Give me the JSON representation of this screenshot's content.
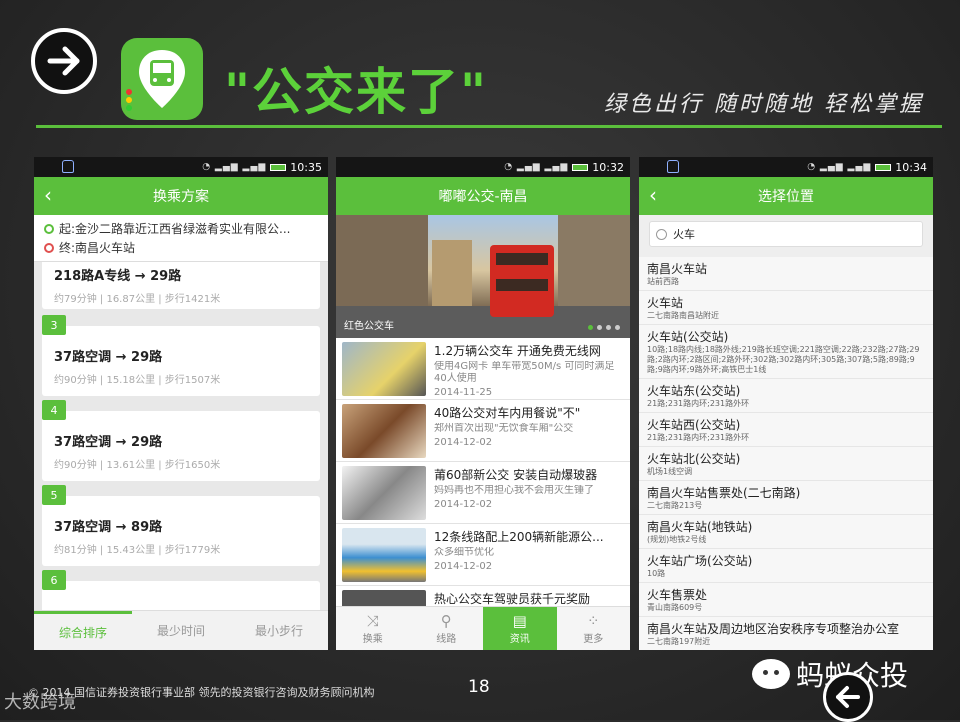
{
  "header": {
    "title": "\"公交来了\"",
    "slogan": "绿色出行 随时随地 轻松掌握"
  },
  "phone1": {
    "time": "10:35",
    "title": "换乘方案",
    "origin": "起:金沙二路靠近江西省绿滋肴实业有限公...",
    "destination": "终:南昌火车站",
    "plans": [
      {
        "num": "",
        "route": "218路A专线 → 29路",
        "meta": "约79分钟 | 16.87公里 | 步行1421米"
      },
      {
        "num": "3",
        "route": "37路空调 → 29路",
        "meta": "约90分钟 | 15.18公里 | 步行1507米"
      },
      {
        "num": "4",
        "route": "37路空调 → 29路",
        "meta": "约90分钟 | 13.61公里 | 步行1650米"
      },
      {
        "num": "5",
        "route": "37路空调 → 89路",
        "meta": "约81分钟 | 15.43公里 | 步行1779米"
      },
      {
        "num": "6",
        "route": "",
        "meta": ""
      }
    ],
    "tabs": [
      "综合排序",
      "最少时间",
      "最小步行"
    ]
  },
  "phone2": {
    "time": "10:32",
    "title": "嘟嘟公交-南昌",
    "banner_caption": "红色公交车",
    "news": [
      {
        "headline": "1.2万辆公交车 开通免费无线网",
        "summary": "使用4G网卡 单车带宽50M/s 可同时满足40人使用",
        "date": "2014-11-25"
      },
      {
        "headline": "40路公交对车内用餐说\"不\"",
        "summary": "郑州首次出现\"无饮食车厢\"公交",
        "date": "2014-12-02"
      },
      {
        "headline": "莆60部新公交 安装自动爆玻器",
        "summary": "妈妈再也不用担心我不会用灭生锤了",
        "date": "2014-12-02"
      },
      {
        "headline": "12条线路配上200辆新能源公...",
        "summary": "众多细节优化",
        "date": "2014-12-02"
      },
      {
        "headline": "热心公交车驾驶员获千元奖励",
        "summary": "",
        "date": ""
      }
    ],
    "tabs": [
      {
        "label": "换乘",
        "icon": "⤨"
      },
      {
        "label": "线路",
        "icon": "⚲"
      },
      {
        "label": "资讯",
        "icon": "▤"
      },
      {
        "label": "更多",
        "icon": "⁘"
      }
    ]
  },
  "phone3": {
    "time": "10:34",
    "title": "选择位置",
    "search_value": "火车",
    "locations": [
      {
        "name": "南昌火车站",
        "addr": "站前西路"
      },
      {
        "name": "火车站",
        "addr": "二七南路南昌站附近"
      },
      {
        "name": "火车站(公交站)",
        "addr": "10路;18路内线;18路外线;219路长班空调;221路空调;22路;232路;27路;29路;2路内环;2路区间;2路外环;302路;302路内环;305路;307路;5路;89路;9路;9路内环;9路外环;高铁巴士1线"
      },
      {
        "name": "火车站东(公交站)",
        "addr": "21路;231路内环;231路外环"
      },
      {
        "name": "火车站西(公交站)",
        "addr": "21路;231路内环;231路外环"
      },
      {
        "name": "火车站北(公交站)",
        "addr": "机场1线空调"
      },
      {
        "name": "南昌火车站售票处(二七南路)",
        "addr": "二七南路213号"
      },
      {
        "name": "南昌火车站(地铁站)",
        "addr": "(规划)地铁2号线"
      },
      {
        "name": "火车站广场(公交站)",
        "addr": "10路"
      },
      {
        "name": "火车售票处",
        "addr": "青山南路609号"
      },
      {
        "name": "南昌火车站及周边地区治安秩序专项整治办公室",
        "addr": "二七南路197附近"
      }
    ]
  },
  "footer": {
    "text": "© 2014   国信证券投资银行事业部  领先的投资银行咨询及财务顾问机构",
    "page": "18",
    "wechat_name": "蚂蚁众投",
    "watermark": "大数跨境"
  },
  "colors": {
    "accent": "#5bbf3c",
    "background": "#2b2b2b"
  }
}
